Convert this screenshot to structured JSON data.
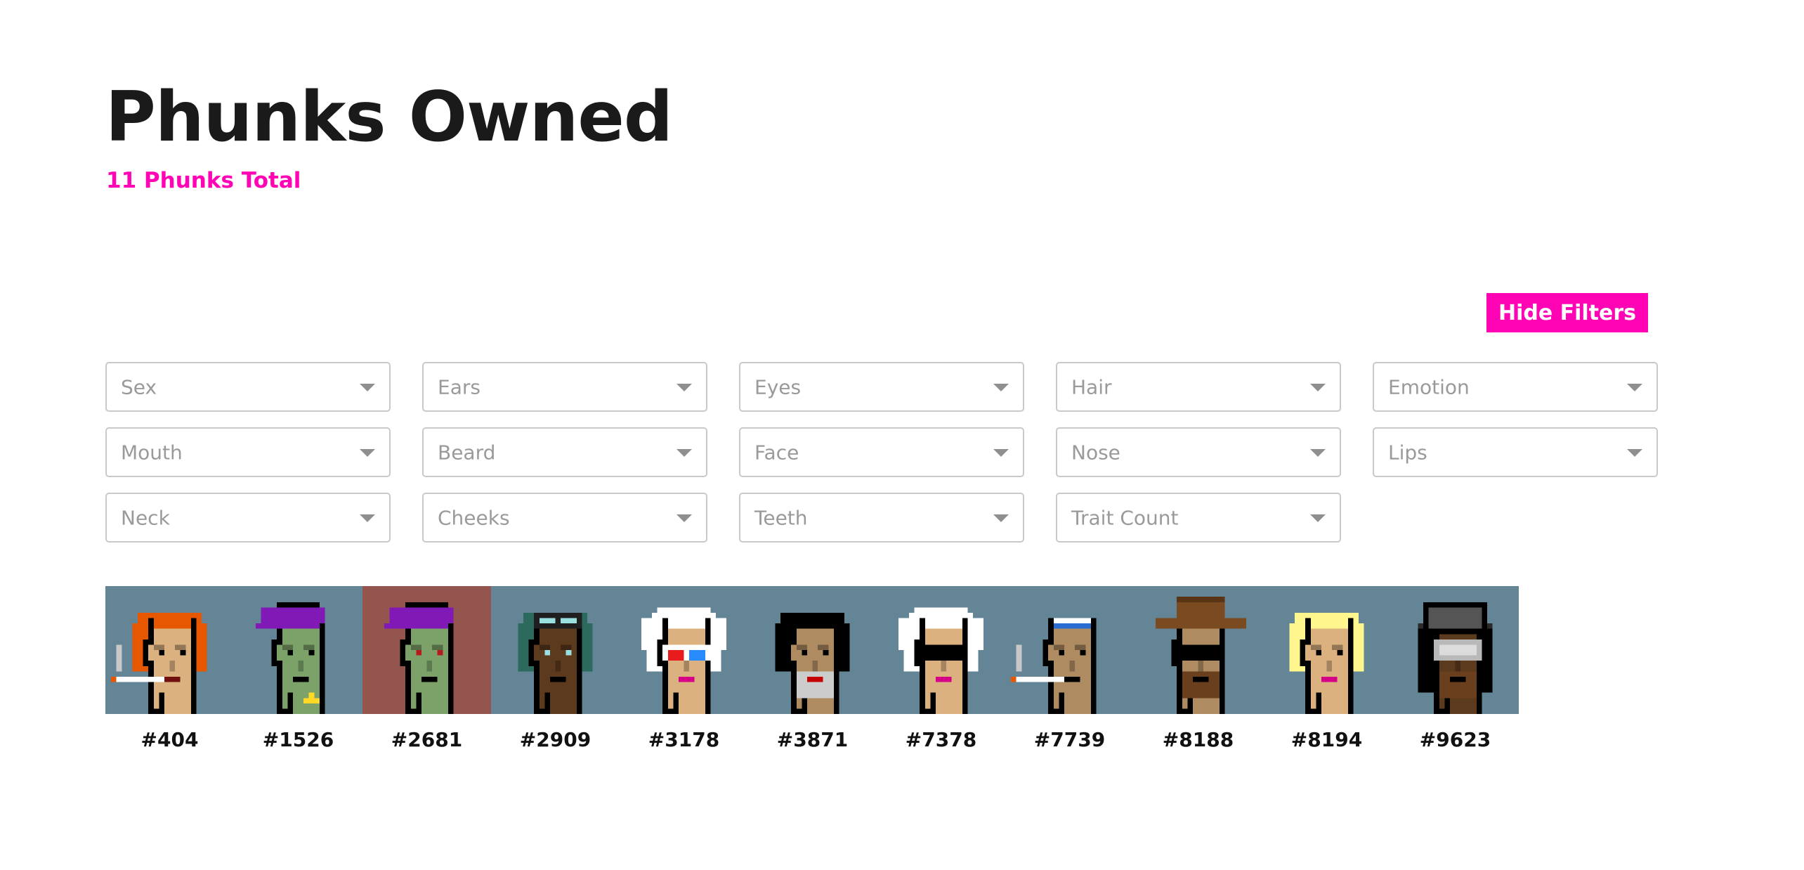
{
  "header": {
    "title": "Phunks Owned",
    "subtitle": "11 Phunks Total"
  },
  "colors": {
    "accent": "#ff04b4",
    "strip_background": "#638596",
    "selected_background": "#95554f"
  },
  "actions": {
    "hide_filters_label": "Hide Filters"
  },
  "filters": [
    {
      "key": "sex",
      "placeholder": "Sex"
    },
    {
      "key": "ears",
      "placeholder": "Ears"
    },
    {
      "key": "eyes",
      "placeholder": "Eyes"
    },
    {
      "key": "hair",
      "placeholder": "Hair"
    },
    {
      "key": "emotion",
      "placeholder": "Emotion"
    },
    {
      "key": "mouth",
      "placeholder": "Mouth"
    },
    {
      "key": "beard",
      "placeholder": "Beard"
    },
    {
      "key": "face",
      "placeholder": "Face"
    },
    {
      "key": "nose",
      "placeholder": "Nose"
    },
    {
      "key": "lips",
      "placeholder": "Lips"
    },
    {
      "key": "neck",
      "placeholder": "Neck"
    },
    {
      "key": "cheeks",
      "placeholder": "Cheeks"
    },
    {
      "key": "teeth",
      "placeholder": "Teeth"
    },
    {
      "key": "trait_count",
      "placeholder": "Trait Count"
    }
  ],
  "phunks": [
    {
      "id": "#404",
      "selected": false,
      "skin": "#dbb180",
      "hair": "#e65700",
      "hat": "",
      "eyes": "#000000",
      "extra": "cigarette",
      "lips": "#711010"
    },
    {
      "id": "#1526",
      "selected": false,
      "skin": "#7da269",
      "hair": "",
      "hat": "#8119b7",
      "eyes": "#000000",
      "extra": "goldchain",
      "lips": ""
    },
    {
      "id": "#2681",
      "selected": true,
      "skin": "#7da269",
      "hair": "",
      "hat": "#8119b7",
      "eyes": "#b61b1b",
      "extra": "",
      "lips": ""
    },
    {
      "id": "#2909",
      "selected": false,
      "skin": "#5c3a1e",
      "hair": "#2b6a5c",
      "hat": "",
      "eyes": "#9be0e0",
      "extra": "goggles",
      "lips": ""
    },
    {
      "id": "#3178",
      "selected": false,
      "skin": "#dbb180",
      "hair": "#ffffff",
      "hat": "",
      "eyes": "3d",
      "extra": "",
      "lips": "#d60088"
    },
    {
      "id": "#3871",
      "selected": false,
      "skin": "#ae8b61",
      "hair": "#000000",
      "hat": "",
      "eyes": "#000000",
      "extra": "beard",
      "lips": "#c40000"
    },
    {
      "id": "#7378",
      "selected": false,
      "skin": "#dbb180",
      "hair": "#ffffff",
      "hat": "",
      "eyes": "shades",
      "extra": "",
      "lips": "#d60088"
    },
    {
      "id": "#7739",
      "selected": false,
      "skin": "#ae8b61",
      "hair": "",
      "hat": "#ffffff",
      "eyes": "#000000",
      "extra": "cigarette",
      "lips": ""
    },
    {
      "id": "#8188",
      "selected": false,
      "skin": "#ae8b61",
      "hair": "",
      "hat": "#7a4b21",
      "eyes": "shades",
      "extra": "beard",
      "lips": ""
    },
    {
      "id": "#8194",
      "selected": false,
      "skin": "#dbb180",
      "hair": "#fff68e",
      "hat": "",
      "eyes": "#000000",
      "extra": "",
      "lips": "#d60088"
    },
    {
      "id": "#9623",
      "selected": false,
      "skin": "#5c3a1e",
      "hair": "#2a2a2a",
      "hat": "#555555",
      "eyes": "vr",
      "extra": "beard",
      "lips": ""
    }
  ]
}
